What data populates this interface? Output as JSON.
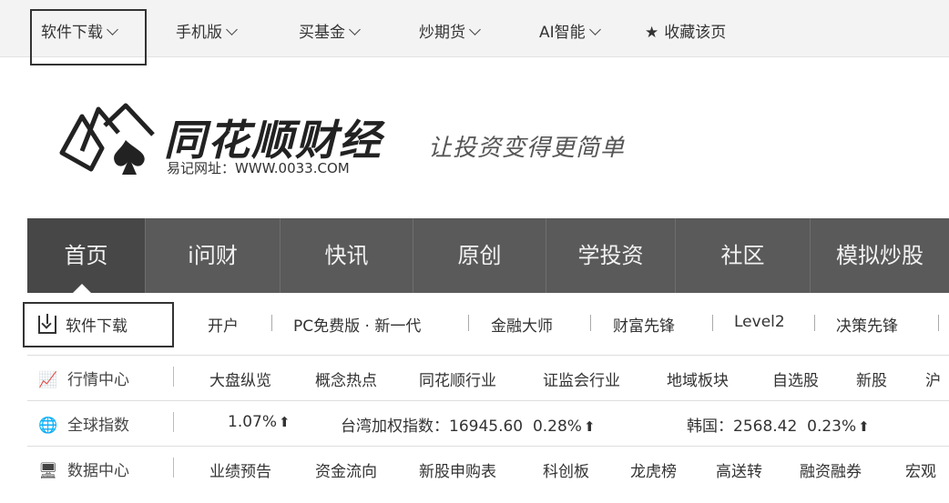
{
  "topbar": {
    "items": [
      {
        "label": "软件下载"
      },
      {
        "label": "手机版"
      },
      {
        "label": "买基金"
      },
      {
        "label": "炒期货"
      },
      {
        "label": "AI智能"
      },
      {
        "label": "收藏该页"
      }
    ]
  },
  "brand": {
    "name": "同花顺财经",
    "url_label": "易记网址：WWW.0033.COM",
    "slogan": "让投资变得更简单"
  },
  "mainnav": {
    "tabs": [
      "首页",
      "i问财",
      "快讯",
      "原创",
      "学投资",
      "社区",
      "模拟炒股"
    ]
  },
  "subnav": {
    "download_label": "软件下载",
    "items": [
      "开户",
      "PC免费版 · 新一代",
      "金融大师",
      "财富先锋",
      "Level2",
      "决策先锋"
    ]
  },
  "market": {
    "head": "行情中心",
    "items": [
      "大盘纵览",
      "概念热点",
      "同花顺行业",
      "证监会行业",
      "地域板块",
      "自选股",
      "新股",
      "沪"
    ]
  },
  "global_index": {
    "head": "全球指数",
    "first_change": "1.07%",
    "taiwan": "台湾加权指数：16945.60",
    "taiwan_change": "0.28%",
    "korea": "韩国：2568.42",
    "korea_change": "0.23%"
  },
  "data_center": {
    "head": "数据中心",
    "items": [
      "业绩预告",
      "资金流向",
      "新股申购表",
      "科创板",
      "龙虎榜",
      "高送转",
      "融资融券",
      "宏观"
    ]
  }
}
